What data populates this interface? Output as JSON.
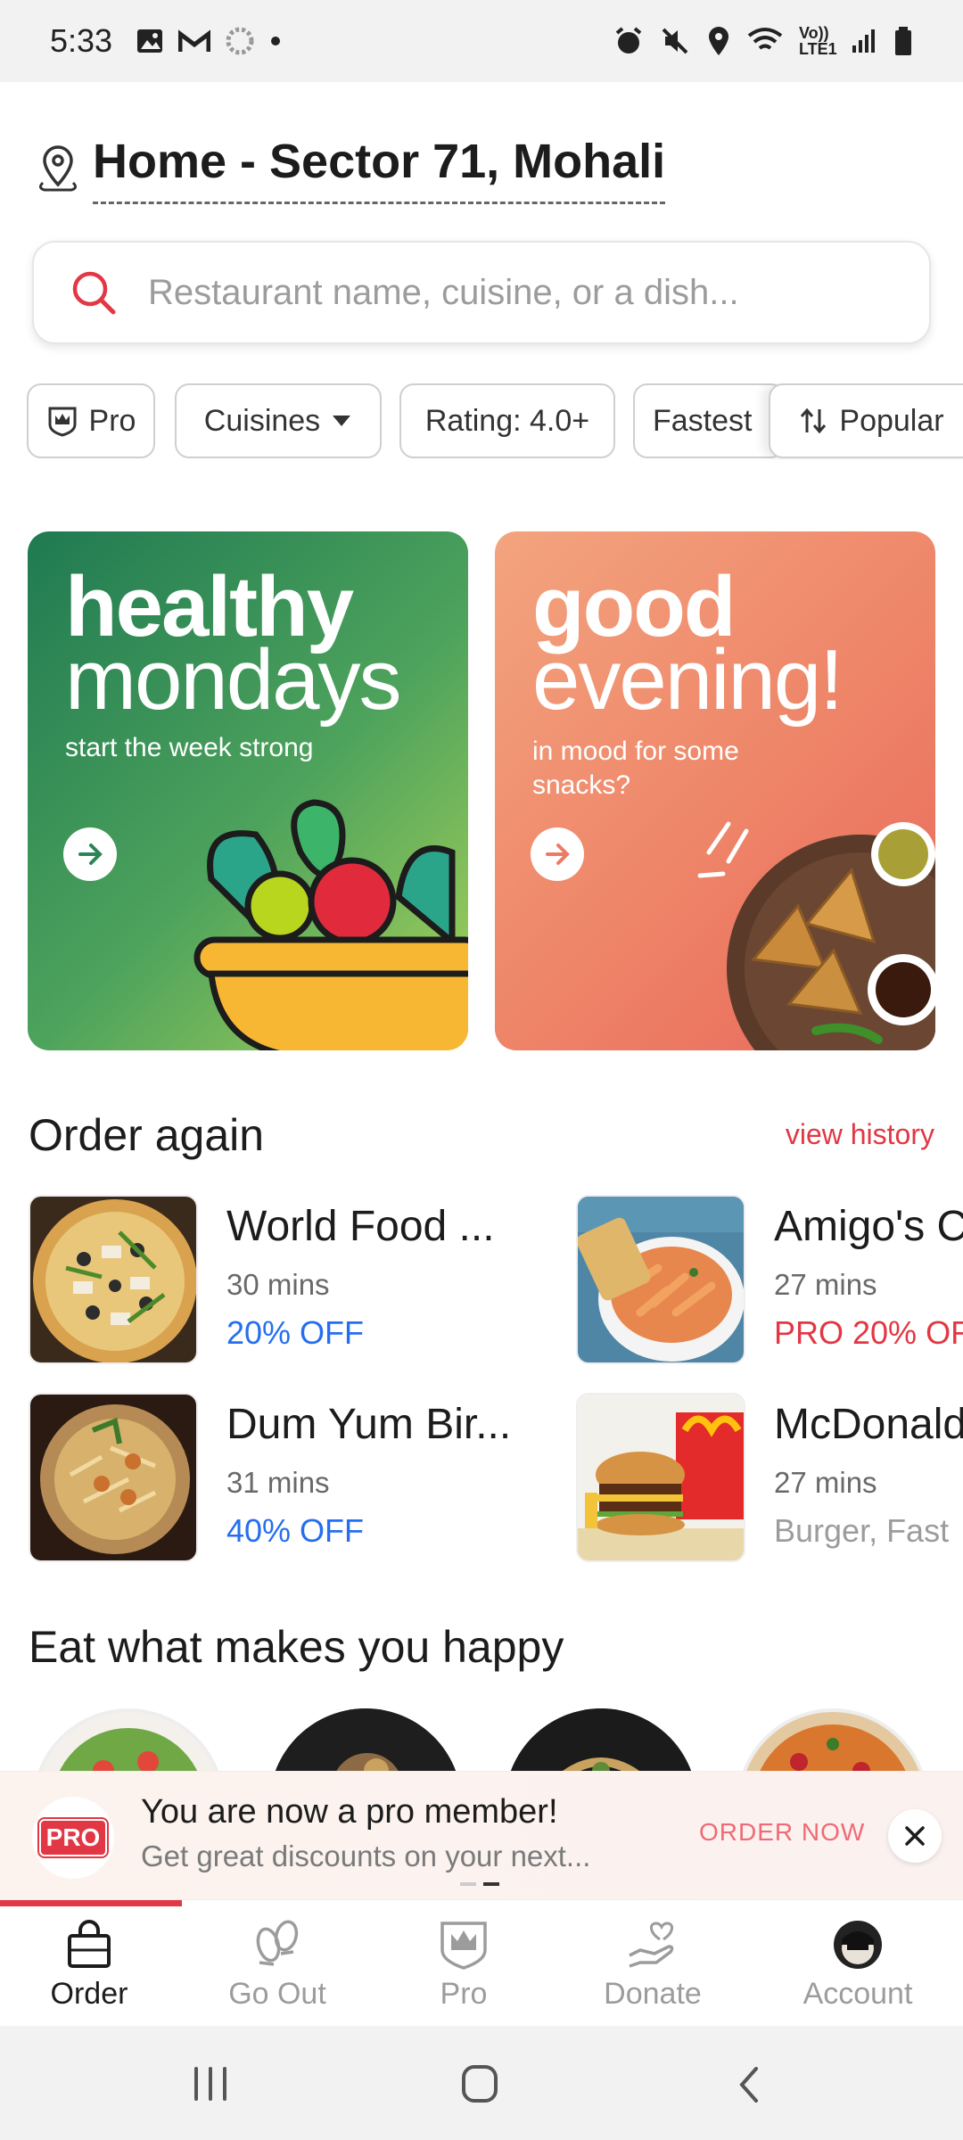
{
  "status_bar": {
    "time": "5:33",
    "network": "Vo)) LTE1"
  },
  "location": {
    "title": "Home - Sector 71, Mohali"
  },
  "search": {
    "placeholder": "Restaurant name, cuisine, or a dish..."
  },
  "filters": [
    {
      "label": "Pro",
      "icon": "pro-crown-icon"
    },
    {
      "label": "Cuisines",
      "icon": "caret-down-icon"
    },
    {
      "label": "Rating: 4.0+"
    },
    {
      "label": "Fastest"
    },
    {
      "label": "Popular",
      "icon": "sort-icon"
    }
  ],
  "banners": [
    {
      "title_line1": "healthy",
      "title_line2": "mondays",
      "subtitle": "start the week strong",
      "gradient": [
        "#1f7a52",
        "#a9d35a"
      ]
    },
    {
      "title_line1": "good",
      "title_line2": "evening!",
      "subtitle": "in mood for some snacks?",
      "gradient": [
        "#f3a47e",
        "#e8675a"
      ]
    }
  ],
  "order_again": {
    "title": "Order again",
    "view_history": "view history",
    "items": [
      {
        "name": "World Food ...",
        "time": "30 mins",
        "offer": "20% OFF",
        "offer_color": "#256fef"
      },
      {
        "name": "Amigo's C",
        "time": "27 mins",
        "offer": "PRO 20% OF",
        "offer_color": "#e23744"
      },
      {
        "name": "Dum Yum Bir...",
        "time": "31 mins",
        "offer": "40% OFF",
        "offer_color": "#256fef"
      },
      {
        "name": "McDonald",
        "time": "27 mins",
        "offer": "Burger, Fast",
        "offer_color": "#9c9c9c"
      }
    ]
  },
  "happy": {
    "title": "Eat what makes you happy"
  },
  "pro_banner": {
    "badge": "PRO",
    "title": "You are now a pro member!",
    "subtitle": "Get great discounts on your next...",
    "cta": "ORDER NOW"
  },
  "bottom_nav": [
    {
      "label": "Order",
      "icon": "shopping-bag-icon",
      "active": true
    },
    {
      "label": "Go Out",
      "icon": "footprints-icon"
    },
    {
      "label": "Pro",
      "icon": "pro-crown-icon"
    },
    {
      "label": "Donate",
      "icon": "donate-hand-heart-icon"
    },
    {
      "label": "Account",
      "icon": "avatar-icon"
    }
  ],
  "colors": {
    "brand": "#e23744",
    "offer_blue": "#256fef"
  }
}
